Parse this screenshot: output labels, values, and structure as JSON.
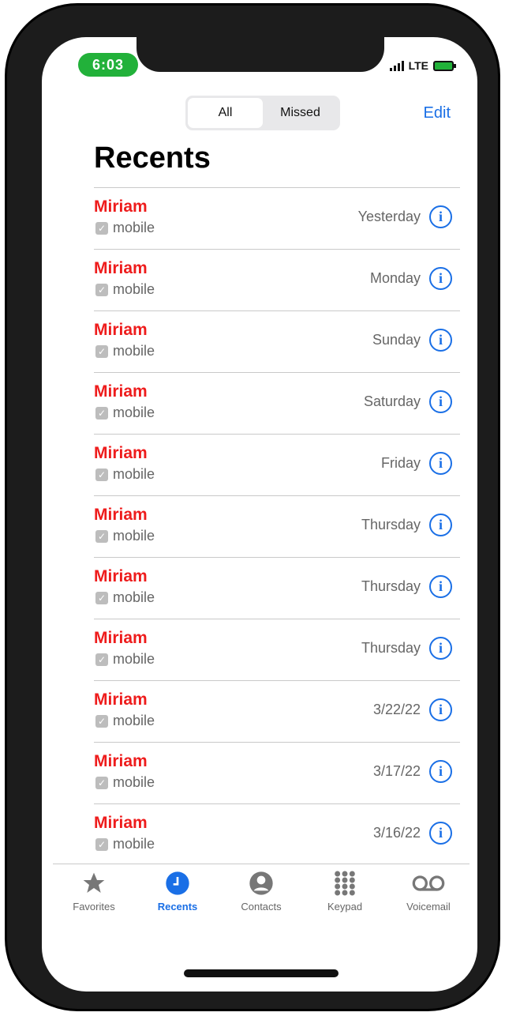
{
  "status": {
    "time": "6:03",
    "network": "LTE"
  },
  "segments": [
    {
      "label": "All",
      "active": true
    },
    {
      "label": "Missed",
      "active": false
    }
  ],
  "edit_label": "Edit",
  "title": "Recents",
  "calls": [
    {
      "name": "Miriam",
      "type": "mobile",
      "when": "Yesterday"
    },
    {
      "name": "Miriam",
      "type": "mobile",
      "when": "Monday"
    },
    {
      "name": "Miriam",
      "type": "mobile",
      "when": "Sunday"
    },
    {
      "name": "Miriam",
      "type": "mobile",
      "when": "Saturday"
    },
    {
      "name": "Miriam",
      "type": "mobile",
      "when": "Friday"
    },
    {
      "name": "Miriam",
      "type": "mobile",
      "when": "Thursday"
    },
    {
      "name": "Miriam",
      "type": "mobile",
      "when": "Thursday"
    },
    {
      "name": "Miriam",
      "type": "mobile",
      "when": "Thursday"
    },
    {
      "name": "Miriam",
      "type": "mobile",
      "when": "3/22/22"
    },
    {
      "name": "Miriam",
      "type": "mobile",
      "when": "3/17/22"
    },
    {
      "name": "Miriam",
      "type": "mobile",
      "when": "3/16/22"
    }
  ],
  "tabs": [
    {
      "label": "Favorites",
      "icon": "star-icon"
    },
    {
      "label": "Recents",
      "icon": "clock-icon",
      "active": true
    },
    {
      "label": "Contacts",
      "icon": "person-icon"
    },
    {
      "label": "Keypad",
      "icon": "keypad-icon"
    },
    {
      "label": "Voicemail",
      "icon": "voicemail-icon"
    }
  ],
  "colors": {
    "accent": "#1a6fe6",
    "caller_name": "#ee1c1c",
    "status_time_bg": "#22b13a"
  }
}
